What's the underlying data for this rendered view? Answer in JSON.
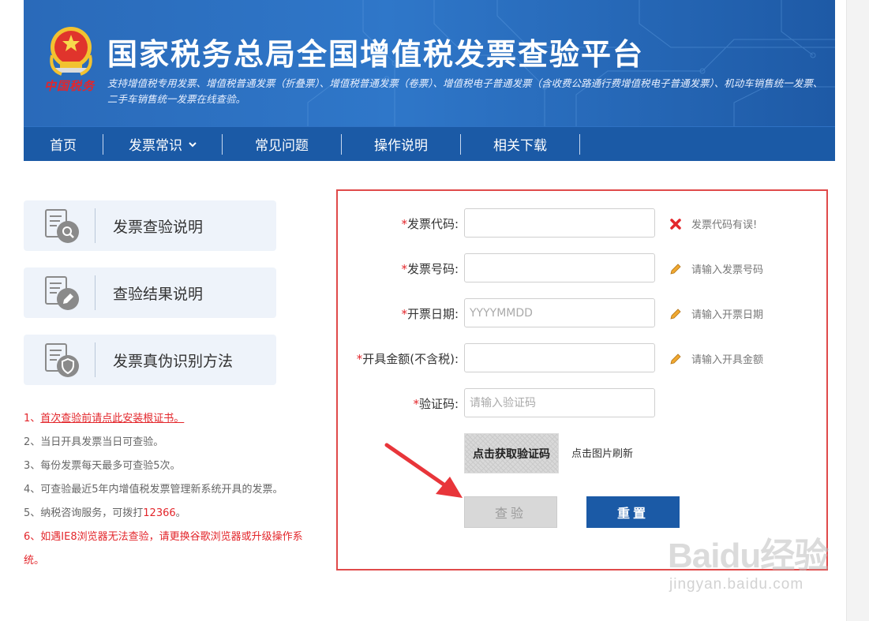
{
  "header": {
    "title": "国家税务总局全国增值税发票查验平台",
    "subtitle": "支持增值税专用发票、增值税普通发票（折叠票）、增值税普通发票（卷票）、增值税电子普通发票（含收费公路通行费增值税电子普通发票）、机动车销售统一发票、二手车销售统一发票在线查验。",
    "emblem_text": "中国税务"
  },
  "nav": {
    "items": [
      {
        "label": "首页"
      },
      {
        "label": "发票常识"
      },
      {
        "label": "常见问题"
      },
      {
        "label": "操作说明"
      },
      {
        "label": "相关下载"
      }
    ]
  },
  "sidebar": {
    "items": [
      {
        "label": "发票查验说明",
        "icon": "doc-search-icon"
      },
      {
        "label": "查验结果说明",
        "icon": "doc-edit-icon"
      },
      {
        "label": "发票真伪识别方法",
        "icon": "doc-shield-icon"
      }
    ]
  },
  "notes": {
    "n1_prefix": "1、",
    "n1_link": "首次查验前请点此安装根证书。",
    "n2": "2、当日开具发票当日可查验。",
    "n3": "3、每份发票每天最多可查验5次。",
    "n4": "4、可查验最近5年内增值税发票管理新系统开具的发票。",
    "n5_prefix": "5、纳税咨询服务，可拨打",
    "n5_phone": "12366",
    "n5_suffix": "。",
    "n6": "6、如遇IE8浏览器无法查验，请更换谷歌浏览器或升级操作系统。"
  },
  "form": {
    "star": "*",
    "code_label": "发票代码:",
    "code_value": "",
    "code_hint": "发票代码有误!",
    "number_label": "发票号码:",
    "number_value": "",
    "number_hint": "请输入发票号码",
    "date_label": "开票日期:",
    "date_placeholder": "YYYYMMDD",
    "date_hint": "请输入开票日期",
    "amount_label": "开具金额(不含税):",
    "amount_value": "",
    "amount_hint": "请输入开具金额",
    "captcha_label": "验证码:",
    "captcha_placeholder": "请输入验证码",
    "captcha_image_text": "点击获取验证码",
    "captcha_tip": "点击图片刷新",
    "check_button": "查验",
    "reset_button": "重置"
  },
  "watermark": {
    "logo": "Baidu经验",
    "url": "jingyan.baidu.com"
  },
  "colors": {
    "brand_blue": "#1b5aa6",
    "banner_blue": "#2f77c9",
    "error_red": "#e3262b",
    "highlight_border": "#e04a4a"
  }
}
